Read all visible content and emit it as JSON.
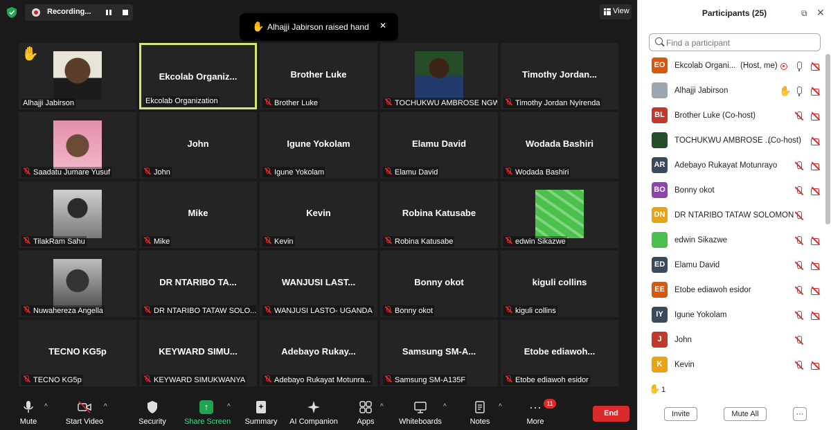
{
  "recording": {
    "label": "Recording..."
  },
  "view": {
    "label": "View"
  },
  "toast": {
    "icon": "✋",
    "message": "Alhajji Jabirson raised hand",
    "close": "✕"
  },
  "tiles": [
    {
      "big": "",
      "name": "Alhajji Jabirson",
      "photo": "p-alhajji",
      "hand": true,
      "muted": false
    },
    {
      "big": "Ekcolab  Organiz...",
      "name": "Ekcolab Organization",
      "active": true,
      "muted": false
    },
    {
      "big": "Brother Luke",
      "name": "Brother Luke",
      "muted": true
    },
    {
      "big": "",
      "name": "TOCHUKWU AMBROSE NGWU",
      "photo": "p-tochukwu",
      "muted": true
    },
    {
      "big": "Timothy  Jordan...",
      "name": "Timothy Jordan Nyirenda",
      "muted": true
    },
    {
      "big": "",
      "name": "Saadatu Jumare Yusuf",
      "photo": "p-saadatu",
      "muted": true
    },
    {
      "big": "John",
      "name": "John",
      "muted": true
    },
    {
      "big": "Igune Yokolam",
      "name": "Igune Yokolam",
      "muted": true
    },
    {
      "big": "Elamu David",
      "name": "Elamu David",
      "muted": true
    },
    {
      "big": "Wodada Bashiri",
      "name": "Wodada Bashiri",
      "muted": true
    },
    {
      "big": "",
      "name": "TilakRam Sahu",
      "photo": "p-tilak",
      "muted": true
    },
    {
      "big": "Mike",
      "name": "Mike",
      "muted": true
    },
    {
      "big": "Kevin",
      "name": "Kevin",
      "muted": true
    },
    {
      "big": "Robina Katusabe",
      "name": "Robina Katusabe",
      "muted": true
    },
    {
      "big": "",
      "name": "edwin Sikazwe",
      "photo": "p-edwin",
      "muted": true
    },
    {
      "big": "",
      "name": "Nuwahereza Angella",
      "photo": "p-nuwa",
      "muted": true
    },
    {
      "big": "DR NTARIBO TA...",
      "name": "DR NTARIBO TATAW SOLO...",
      "muted": true
    },
    {
      "big": "WANJUSI LAST...",
      "name": "WANJUSI LASTO- UGANDA",
      "muted": true
    },
    {
      "big": "Bonny okot",
      "name": "Bonny okot",
      "muted": true
    },
    {
      "big": "kiguli collins",
      "name": "kiguli collins",
      "muted": true
    },
    {
      "big": "TECNO KG5p",
      "name": "TECNO KG5p",
      "muted": true
    },
    {
      "big": "KEYWARD  SIMU...",
      "name": "KEYWARD SIMUKWANYA",
      "muted": true
    },
    {
      "big": "Adebayo  Rukay...",
      "name": "Adebayo Rukayat Motunra...",
      "muted": true
    },
    {
      "big": "Samsung  SM-A...",
      "name": "Samsung SM-A135F",
      "muted": true
    },
    {
      "big": "Etobe  ediawoh...",
      "name": "Etobe ediawoh esidor",
      "muted": true
    }
  ],
  "toolbar": {
    "mute": "Mute",
    "start_video": "Start Video",
    "security": "Security",
    "share_screen": "Share Screen",
    "summary": "Summary",
    "ai_companion": "AI Companion",
    "apps": "Apps",
    "whiteboards": "Whiteboards",
    "notes": "Notes",
    "more": "More",
    "more_badge": "11",
    "end": "End"
  },
  "panel": {
    "title": "Participants (25)",
    "search_placeholder": "Find a participant",
    "participants": [
      {
        "initials": "EO",
        "color": "#d9580f",
        "name": "Ekcolab Organi...",
        "role": "(Host, me)",
        "rec": true,
        "mic": "on",
        "cam": "off"
      },
      {
        "initials": "",
        "color": "#9aa6b2",
        "name": "Alhajji Jabirson",
        "role": "",
        "hand": true,
        "mic": "on",
        "cam": "off",
        "photo": true
      },
      {
        "initials": "BL",
        "color": "#c0392b",
        "name": "Brother Luke (Co-host)",
        "role": "",
        "mic": "off",
        "cam": "off"
      },
      {
        "initials": "",
        "color": "#264d2a",
        "name": "TOCHUKWU AMBROSE ...",
        "role": "(Co-host)",
        "mic": "none",
        "cam": "off",
        "photo": true
      },
      {
        "initials": "AR",
        "color": "#3a4a5c",
        "name": "Adebayo Rukayat Motunrayo",
        "role": "",
        "mic": "off",
        "cam": "off"
      },
      {
        "initials": "BO",
        "color": "#8e44ad",
        "name": "Bonny okot",
        "role": "",
        "mic": "off",
        "cam": "off"
      },
      {
        "initials": "DN",
        "color": "#e8a317",
        "name": "DR NTARIBO TATAW SOLOMON",
        "role": "",
        "mic": "off",
        "cam": "none"
      },
      {
        "initials": "",
        "color": "#4dbf4d",
        "name": "edwin Sikazwe",
        "role": "",
        "mic": "off",
        "cam": "off",
        "photo": true
      },
      {
        "initials": "ED",
        "color": "#3a4a5c",
        "name": "Elamu David",
        "role": "",
        "mic": "off",
        "cam": "off"
      },
      {
        "initials": "EE",
        "color": "#d9580f",
        "name": "Etobe ediawoh esidor",
        "role": "",
        "mic": "off",
        "cam": "off"
      },
      {
        "initials": "IY",
        "color": "#3a4a5c",
        "name": "Igune Yokolam",
        "role": "",
        "mic": "off",
        "cam": "off"
      },
      {
        "initials": "J",
        "color": "#c0392b",
        "name": "John",
        "role": "",
        "mic": "off",
        "cam": "none"
      },
      {
        "initials": "K",
        "color": "#e8a317",
        "name": "Kevin",
        "role": "",
        "mic": "off",
        "cam": "off"
      }
    ],
    "raised_hands_icon": "✋",
    "raised_hands_count": "1",
    "invite": "Invite",
    "mute_all": "Mute All",
    "more": "···"
  }
}
